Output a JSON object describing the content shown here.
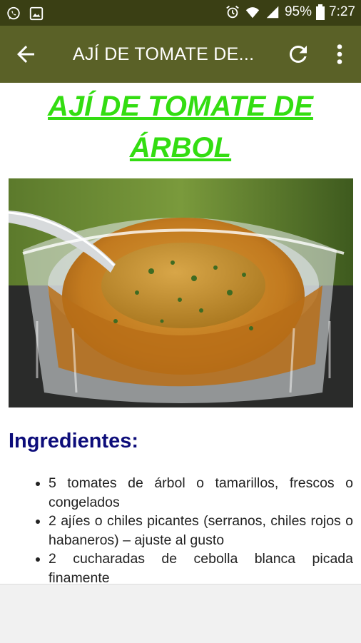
{
  "status_bar": {
    "battery": "95%",
    "time": "7:27",
    "icons": [
      "whatsapp-icon",
      "gallery-icon",
      "alarm-icon",
      "wifi-icon",
      "signal-icon",
      "battery-icon"
    ]
  },
  "app_bar": {
    "title": "AJÍ DE TOMATE DE...",
    "icons": [
      "back-arrow-icon",
      "refresh-icon",
      "more-vert-icon"
    ]
  },
  "article": {
    "title_line1": "AJÍ DE TOMATE DE",
    "title_line2": "ÁRBOL",
    "ingredients_heading": "Ingredientes:",
    "ingredients": [
      "5 tomates de árbol o tamarillos, frescos o congelados",
      "2 ajíes o chiles picantes (serranos, chiles rojos o habaneros) – ajuste al gusto",
      "2 cucharadas de cebolla blanca picada finamente"
    ]
  },
  "colors": {
    "status_bar": "#3a3f14",
    "app_bar": "#5a6127",
    "title_green": "#33dd11",
    "heading_navy": "#0d0d7a"
  }
}
